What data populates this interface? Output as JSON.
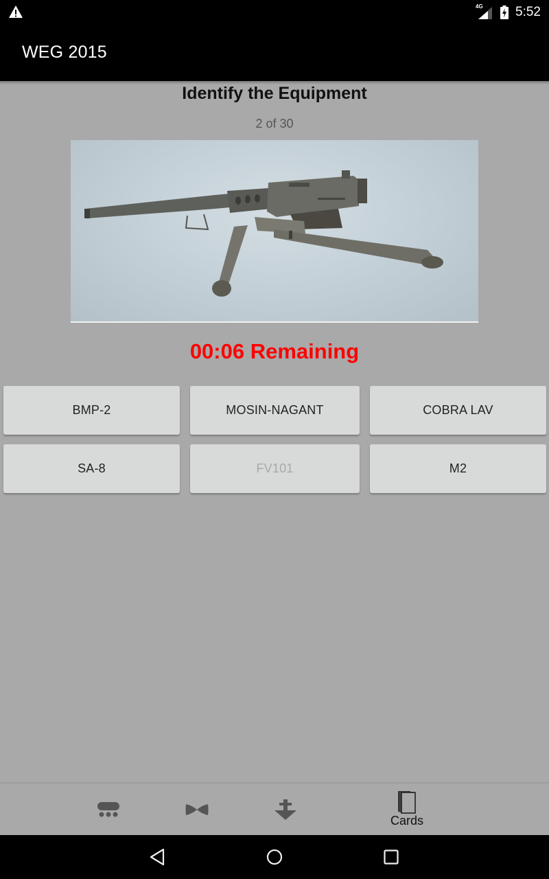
{
  "status_bar": {
    "time": "5:52",
    "network_label": "4G",
    "icons": [
      "warning-icon",
      "signal-4g-icon",
      "battery-charging-icon"
    ]
  },
  "app_bar": {
    "title": "WEG 2015"
  },
  "quiz": {
    "heading": "Identify the Equipment",
    "progress": "2 of 30",
    "image_subject": "M2 heavy machine gun on tripod",
    "timer": "00:06 Remaining",
    "answers": [
      {
        "label": "BMP-2",
        "enabled": true
      },
      {
        "label": "MOSIN-NAGANT",
        "enabled": true
      },
      {
        "label": "COBRA LAV",
        "enabled": true
      },
      {
        "label": "SA-8",
        "enabled": true
      },
      {
        "label": "FV101",
        "enabled": false
      },
      {
        "label": "M2",
        "enabled": true
      }
    ]
  },
  "tabs": [
    {
      "icon": "tank-icon",
      "label": ""
    },
    {
      "icon": "aircraft-icon",
      "label": ""
    },
    {
      "icon": "ship-anchor-icon",
      "label": ""
    },
    {
      "icon": "cards-icon",
      "label": "Cards"
    }
  ],
  "nav_bar": {
    "buttons": [
      "back",
      "home",
      "recents"
    ]
  },
  "colors": {
    "timer": "#ff0000",
    "background": "#a9a9a9",
    "button": "#d8d9d9",
    "bars": "#000000"
  }
}
